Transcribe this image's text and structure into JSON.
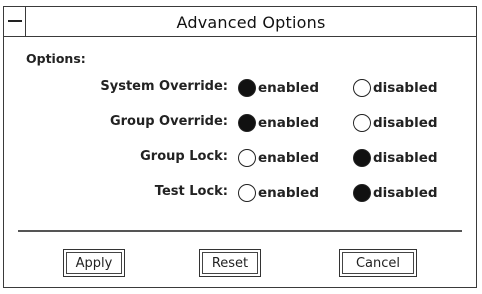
{
  "window": {
    "title": "Advanced Options"
  },
  "options": {
    "section_label": "Options:",
    "rows": [
      {
        "label": "System Override:",
        "enabled_label": "enabled",
        "disabled_label": "disabled",
        "selected": "enabled"
      },
      {
        "label": "Group Override:",
        "enabled_label": "enabled",
        "disabled_label": "disabled",
        "selected": "enabled"
      },
      {
        "label": "Group Lock:",
        "enabled_label": "enabled",
        "disabled_label": "disabled",
        "selected": "disabled"
      },
      {
        "label": "Test Lock:",
        "enabled_label": "enabled",
        "disabled_label": "disabled",
        "selected": "disabled"
      }
    ]
  },
  "buttons": {
    "apply": "Apply",
    "reset": "Reset",
    "cancel": "Cancel"
  }
}
